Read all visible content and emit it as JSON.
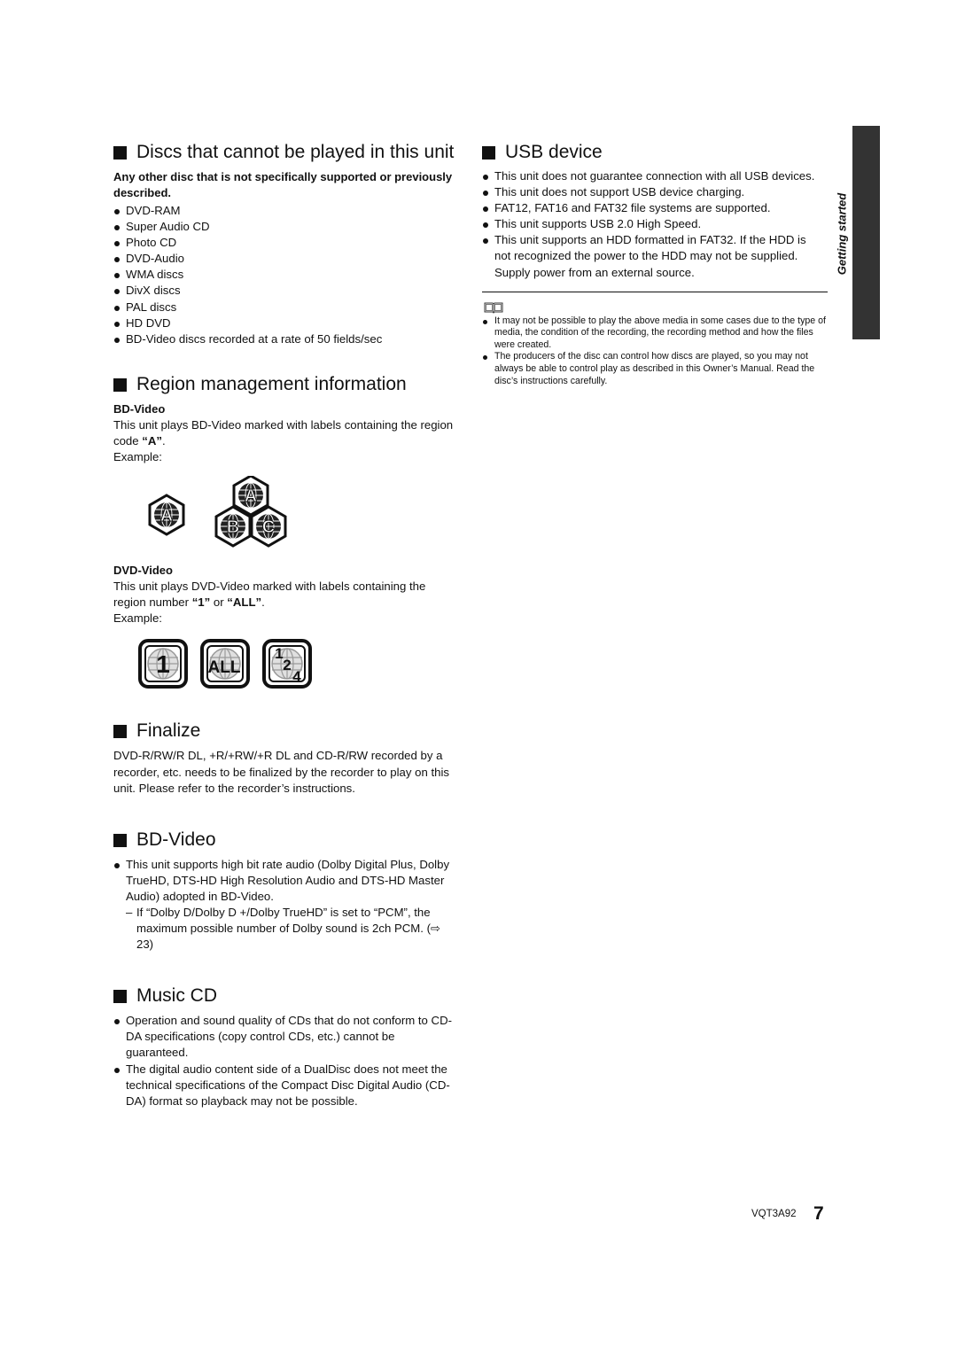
{
  "side_tab": {
    "label": "Getting started"
  },
  "sections": {
    "discs_cannot": {
      "title": "Discs that cannot be played in this unit",
      "intro": "Any other disc that is not specifically supported or previously described.",
      "items": [
        "DVD-RAM",
        "Super Audio CD",
        "Photo CD",
        "DVD-Audio",
        "WMA discs",
        "DivX discs",
        "PAL discs",
        "HD DVD",
        "BD-Video discs recorded at a rate of 50 fields/sec"
      ]
    },
    "region": {
      "title": "Region management information",
      "bd": {
        "heading": "BD-Video",
        "text_pre": "This unit plays BD-Video marked with labels containing the region code ",
        "code": "“A”",
        "text_post": ".",
        "example": "Example:",
        "logo_single": "A",
        "logo_group": [
          "A",
          "B",
          "C"
        ]
      },
      "dvd": {
        "heading": "DVD-Video",
        "text_pre": "This unit plays DVD-Video marked with labels containing the region number ",
        "code1": "“1”",
        "or": " or ",
        "code2": "“ALL”",
        "text_post": ".",
        "example": "Example:",
        "logos": [
          "1",
          "ALL",
          "1 2 4"
        ]
      }
    },
    "finalize": {
      "title": "Finalize",
      "text": "DVD-R/RW/R DL, +R/+RW/+R DL and CD-R/RW recorded by a recorder, etc. needs to be finalized by the recorder to play on this unit. Please refer to the recorder’s instructions."
    },
    "bdvideo": {
      "title": "BD-Video",
      "item": "This unit supports high bit rate audio (Dolby Digital Plus, Dolby TrueHD, DTS-HD High Resolution Audio and DTS-HD Master Audio) adopted in BD-Video.",
      "sub_dash": "–",
      "sub": "If “Dolby D/Dolby D +/Dolby TrueHD” is set to “PCM”, the maximum possible number of Dolby sound is 2ch PCM. (⇨ 23)"
    },
    "musiccd": {
      "title": "Music CD",
      "items": [
        "Operation and sound quality of CDs that do not conform to CD-DA specifications (copy control CDs, etc.) cannot be guaranteed.",
        "The digital audio content side of a DualDisc does not meet the technical specifications of the Compact Disc Digital Audio (CD-DA) format so playback may not be possible."
      ]
    },
    "usb": {
      "title": "USB device",
      "items": [
        "This unit does not guarantee connection with all USB devices.",
        "This unit does not support USB device charging.",
        "FAT12, FAT16 and FAT32 file systems are supported.",
        "This unit supports USB 2.0 High Speed.",
        "This unit supports an HDD formatted in FAT32. If the HDD is not recognized the power to the HDD may not be supplied. Supply power from an external source."
      ]
    },
    "note": {
      "icon": "book-icon",
      "items": [
        "It may not be possible to play the above media in some cases due to the type of media, the condition of the recording, the recording method and how the files were created.",
        "The producers of the disc can control how discs are played, so you may not always be able to control play as described in this Owner’s Manual. Read the disc’s instructions carefully."
      ]
    }
  },
  "footer": {
    "code": "VQT3A92",
    "page": "7"
  }
}
